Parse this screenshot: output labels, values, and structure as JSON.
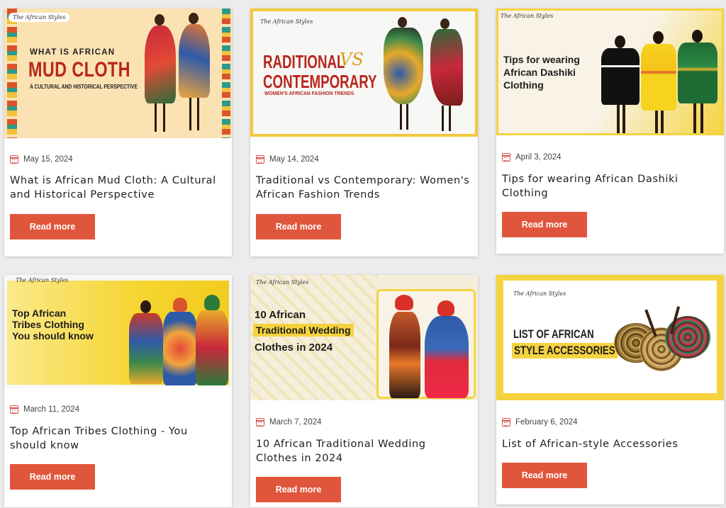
{
  "cards": [
    {
      "date": "May 15, 2024",
      "title": "What is African Mud Cloth: A Cultural and Historical Perspective",
      "button": "Read more",
      "thumb": {
        "logo": "The African Styles",
        "line1": "WHAT IS AFRICAN",
        "line2": "MUD CLOTH",
        "line3": "A CULTURAL AND HISTORICAL PERSPECTIVE"
      }
    },
    {
      "date": "May 14, 2024",
      "title": "Traditional vs Contemporary: Women's African Fashion Trends",
      "button": "Read more",
      "thumb": {
        "logo": "The African Styles",
        "line1": "RADITIONAL",
        "line1b": "VS",
        "line2": "CONTEMPORARY",
        "line3": "WOMEN'S AFRICAN FASHION TRENDS"
      }
    },
    {
      "date": "April 3, 2024",
      "title": "Tips for wearing African Dashiki Clothing",
      "button": "Read more",
      "thumb": {
        "logo": "The African Styles",
        "line1": "Tips for wearing",
        "line2": "African Dashiki",
        "line3": "Clothing"
      }
    },
    {
      "date": "March 11, 2024",
      "title": "Top African Tribes Clothing - You should know",
      "button": "Read more",
      "thumb": {
        "logo": "The African Styles",
        "line1": "Top African",
        "line2": "Tribes Clothing",
        "line3": "You should know"
      }
    },
    {
      "date": "March 7, 2024",
      "title": "10 African Traditional Wedding Clothes in 2024",
      "button": "Read more",
      "thumb": {
        "logo": "The African Styles",
        "line1": "10 African",
        "line2": "Traditional Wedding",
        "line3": "Clothes in 2024"
      }
    },
    {
      "date": "February 6, 2024",
      "title": "List of African-style Accessories",
      "button": "Read more",
      "thumb": {
        "logo": "The African Styles",
        "line1": "LIST OF AFRICAN",
        "line2": "STYLE ACCESSORIES"
      }
    }
  ],
  "colors": {
    "accent": "#e0563c",
    "yellow": "#f5d23a",
    "calendar": "#d9534f"
  }
}
